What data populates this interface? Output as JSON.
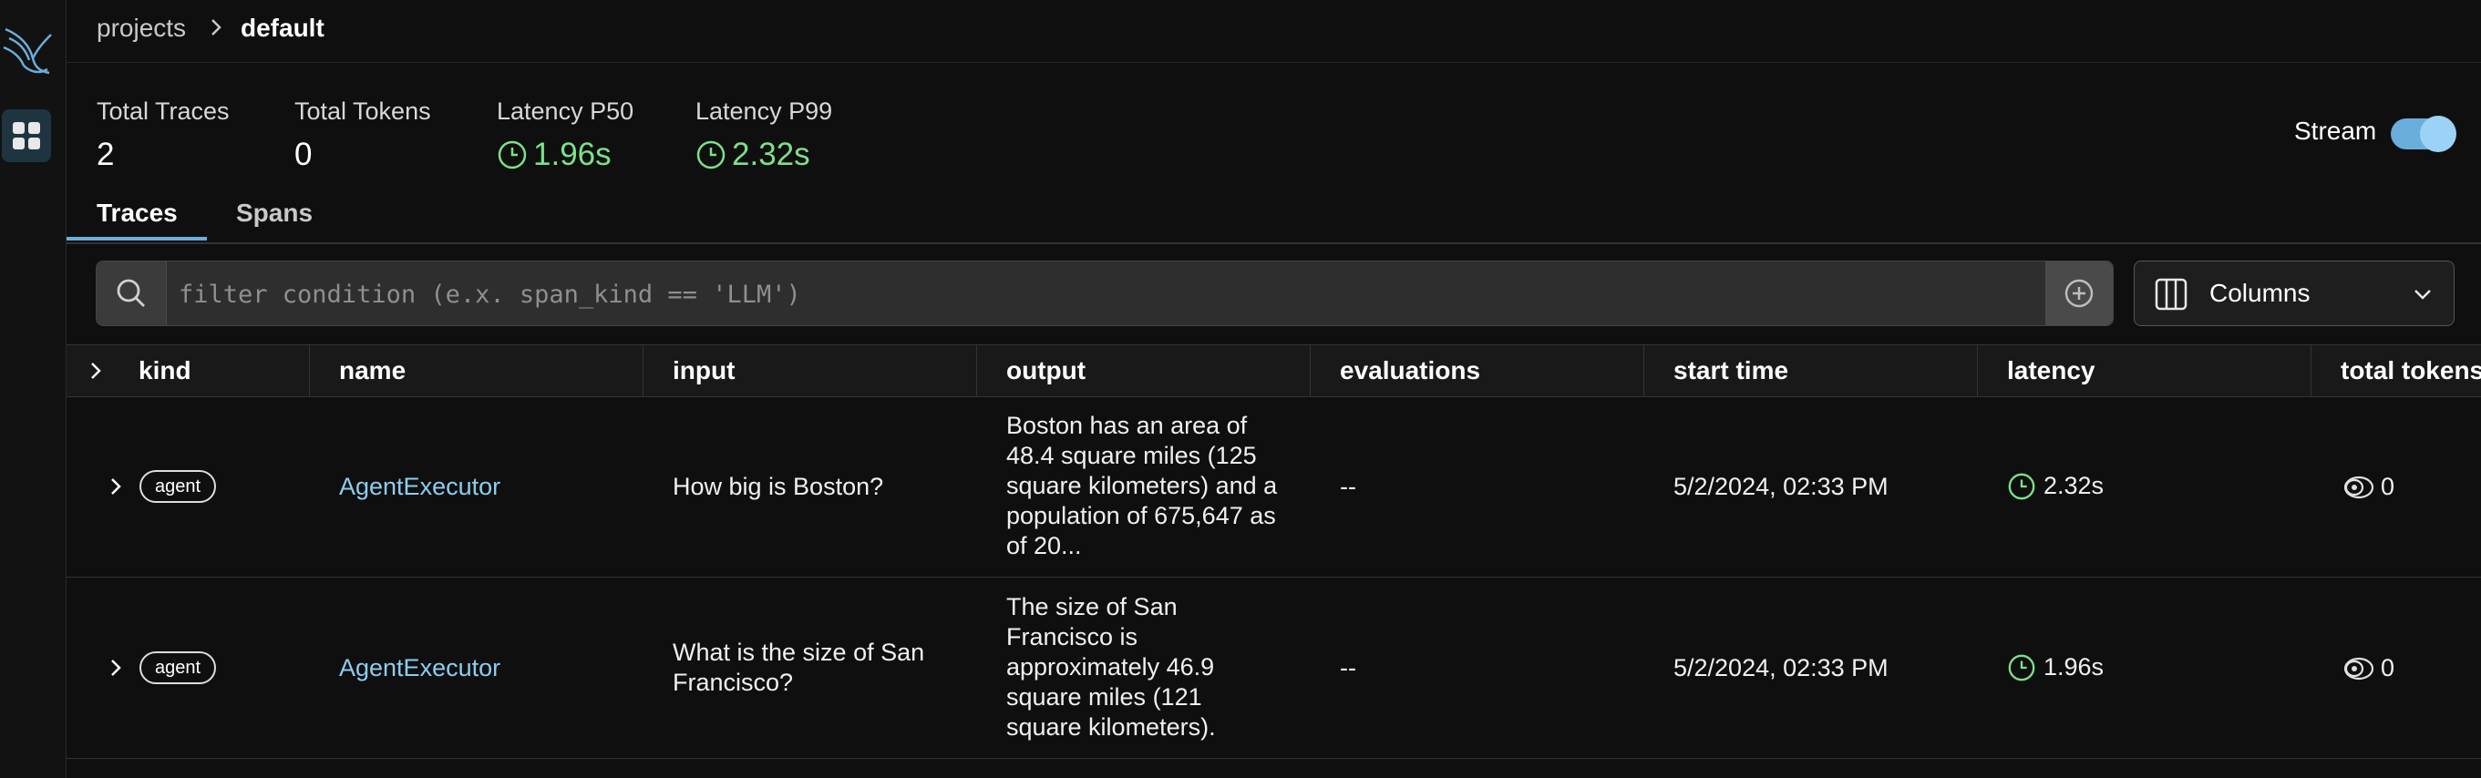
{
  "breadcrumb": {
    "parent": "projects",
    "current": "default"
  },
  "stats": [
    {
      "label": "Total Traces",
      "value": "2"
    },
    {
      "label": "Total Tokens",
      "value": "0"
    },
    {
      "label": "Latency P50",
      "value": "1.96s"
    },
    {
      "label": "Latency P99",
      "value": "2.32s"
    }
  ],
  "stream": {
    "label": "Stream",
    "enabled": true
  },
  "tabs": [
    {
      "label": "Traces",
      "active": true
    },
    {
      "label": "Spans",
      "active": false
    }
  ],
  "filter": {
    "placeholder": "filter condition (e.x. span_kind == 'LLM')",
    "value": ""
  },
  "columns_button": {
    "label": "Columns"
  },
  "table": {
    "headers": [
      "kind",
      "name",
      "input",
      "output",
      "evaluations",
      "start time",
      "latency",
      "total tokens"
    ],
    "rows": [
      {
        "kind": "agent",
        "name": "AgentExecutor",
        "input": "How big is Boston?",
        "output": "Boston has an area of 48.4 square miles (125 square kilometers) and a population of 675,647 as of 20...",
        "evaluations": "--",
        "start_time": "5/2/2024, 02:33 PM",
        "latency": "2.32s",
        "total_tokens": "0"
      },
      {
        "kind": "agent",
        "name": "AgentExecutor",
        "input": "What is the size of San Francisco?",
        "output": "The size of San Francisco is approximately 46.9 square miles (121 square kilometers).",
        "evaluations": "--",
        "start_time": "5/2/2024, 02:33 PM",
        "latency": "1.96s",
        "total_tokens": "0"
      }
    ]
  },
  "colors": {
    "accent": "#6aaedb",
    "latency": "#7ee08a",
    "link": "#8ccdf0",
    "background": "#0f0f0f"
  }
}
